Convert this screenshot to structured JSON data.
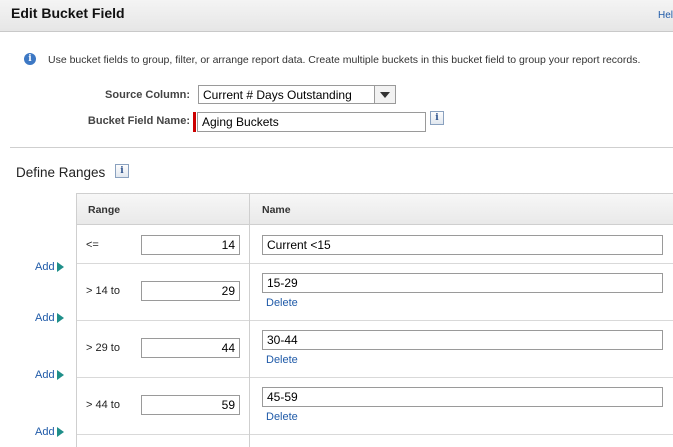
{
  "header": {
    "title": "Edit Bucket Field",
    "help": "Hel"
  },
  "info": {
    "text": "Use bucket fields to group, filter, or arrange report data. Create multiple buckets in this bucket field to group your report records."
  },
  "source_column": {
    "label": "Source Column:",
    "value": "Current # Days Outstanding"
  },
  "bucket_field_name": {
    "label": "Bucket Field Name:",
    "value": "Aging Buckets"
  },
  "define_ranges": {
    "title": "Define Ranges",
    "headers": {
      "range": "Range",
      "name": "Name"
    },
    "add_label": "Add",
    "delete_label": "Delete",
    "rows": [
      {
        "range_label": "<=",
        "value": "14",
        "name": "Current <15",
        "has_delete": false
      },
      {
        "range_label": "> 14 to",
        "value": "29",
        "name": "15-29",
        "has_delete": true
      },
      {
        "range_label": "> 29 to",
        "value": "44",
        "name": "30-44",
        "has_delete": true
      },
      {
        "range_label": "> 44 to",
        "value": "59",
        "name": "45-59",
        "has_delete": true
      }
    ]
  },
  "colors": {
    "link": "#1f5aa8",
    "info": "#3d78c4",
    "required": "#cc0000"
  }
}
